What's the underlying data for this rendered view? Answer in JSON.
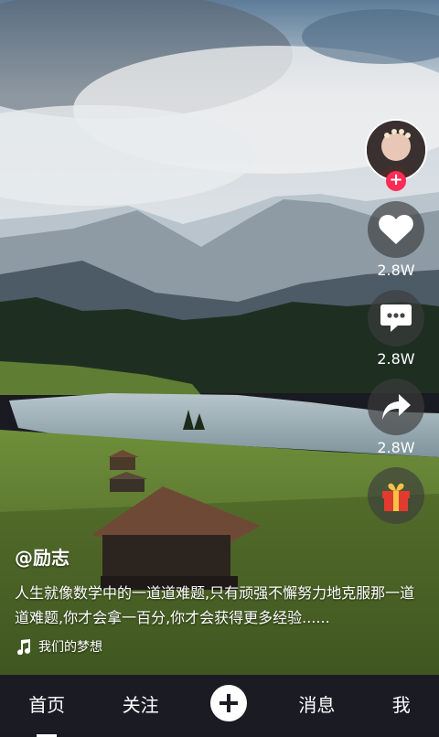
{
  "post": {
    "username": "@励志",
    "description": "人生就像数学中的一道道难题,只有顽强不懈努力地克服那一道道难题,你才会拿一百分,你才会获得更多经验......",
    "music": "我们的梦想"
  },
  "actions": {
    "like_count": "2.8W",
    "comment_count": "2.8W",
    "share_count": "2.8W"
  },
  "nav": {
    "home": "首页",
    "follow": "关注",
    "messages": "消息",
    "me": "我"
  },
  "icons": {
    "follow": "plus-icon",
    "like": "heart-icon",
    "comment": "comment-icon",
    "share": "share-icon",
    "gift": "gift-icon",
    "music": "music-note-icon",
    "create": "plus-icon"
  },
  "colors": {
    "accent": "#ff2a55",
    "nav_bg": "#1b1b24",
    "gift_red": "#e23a2e",
    "gift_gold": "#f6c246"
  }
}
